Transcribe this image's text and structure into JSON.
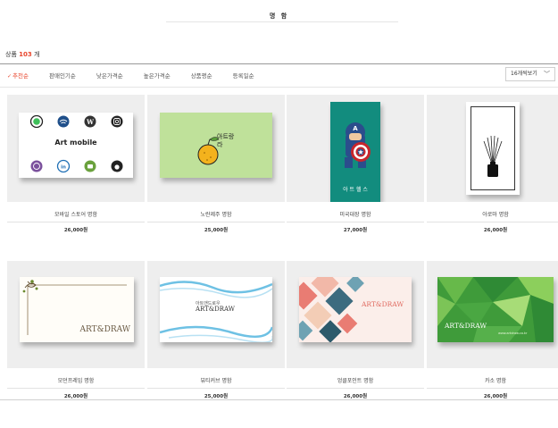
{
  "page": {
    "title": "명 함"
  },
  "summary": {
    "label": "상품",
    "count": "103",
    "unit": "개"
  },
  "sort": {
    "options": [
      "추천순",
      "판매인기순",
      "낮은가격순",
      "높은가격순",
      "상품평순",
      "등록일순"
    ],
    "active_index": 0,
    "check_glyph": "✓"
  },
  "view": {
    "selected": "16개씩보기",
    "chevron": "﹀"
  },
  "products": [
    {
      "name": "모바일 스토어 명함",
      "price": "26,000원",
      "card_text": "Art mobile"
    },
    {
      "name": "노란제주 명함",
      "price": "25,000원",
      "card_text": "아트랑 라"
    },
    {
      "name": "미국대장 명함",
      "price": "27,000원",
      "card_text": "아 트 헬 스"
    },
    {
      "name": "아로마 명함",
      "price": "26,000원"
    },
    {
      "name": "모던프레임 명함",
      "price": "26,000원",
      "card_text": "ART&DRAW"
    },
    {
      "name": "뷰티커브 명함",
      "price": "25,000원",
      "card_text_small": "아트앤드로우",
      "card_text": "ART&DRAW"
    },
    {
      "name": "엉클포인트 명함",
      "price": "26,000원",
      "card_text": "ART&DRAW"
    },
    {
      "name": "카소 명함",
      "price": "26,000원",
      "card_text": "ART&DRAW",
      "card_subtext": "www.artdraw.co.kr"
    }
  ],
  "colors": {
    "accent": "#e8452c",
    "thumb_bg": "#eeeeee",
    "green_card": "#bfe19a",
    "teal_card": "#128c7e"
  },
  "icons": [
    "whatsapp-icon",
    "wifi-icon",
    "wordpress-icon",
    "instagram-icon",
    "viber-icon",
    "linkedin-icon",
    "android-icon",
    "apple-icon",
    "orange-icon",
    "captain-icon",
    "diffuser-icon",
    "vine-ornament-icon",
    "wave-ornament-icon"
  ]
}
